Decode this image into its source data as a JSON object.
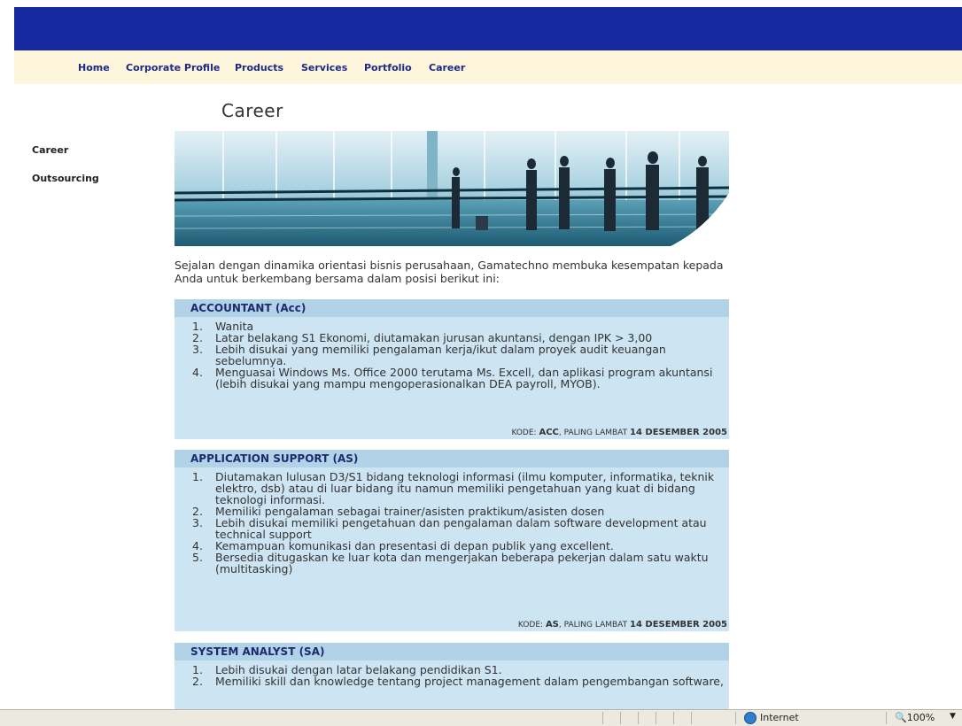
{
  "nav": {
    "items": [
      {
        "label": "Home"
      },
      {
        "label": "Corporate Profile"
      },
      {
        "label": "Products"
      },
      {
        "label": "Services"
      },
      {
        "label": "Portfolio"
      },
      {
        "label": "Career"
      }
    ]
  },
  "sidebar": {
    "items": [
      {
        "label": "Career"
      },
      {
        "label": "Outsourcing"
      }
    ]
  },
  "page": {
    "title": "Career",
    "intro": "Sejalan dengan dinamika orientasi bisnis perusahaan, Gamatechno membuka kesempatan kepada Anda untuk berkembang bersama dalam posisi berikut ini:"
  },
  "jobs": [
    {
      "title": "ACCOUNTANT (Acc)",
      "items": [
        "Wanita",
        "Latar belakang S1 Ekonomi, diutamakan jurusan akuntansi, dengan IPK > 3,00",
        "Lebih disukai yang memiliki pengalaman kerja/ikut dalam proyek audit keuangan sebelumnya.",
        "Menguasai Windows Ms. Office 2000 terutama Ms. Excell, dan aplikasi program akuntansi (lebih disukai yang mampu mengoperasionalkan DEA payroll, MYOB)."
      ],
      "code_label": "KODE:",
      "code": "ACC",
      "deadline_label": ", PALING LAMBAT",
      "deadline": "14 DESEMBER 2005"
    },
    {
      "title": "APPLICATION SUPPORT (AS)",
      "items": [
        "Diutamakan lulusan D3/S1 bidang teknologi informasi (ilmu komputer, informatika, teknik elektro, dsb) atau di luar bidang itu namun memiliki pengetahuan yang kuat di bidang teknologi informasi.",
        "Memiliki pengalaman sebagai trainer/asisten praktikum/asisten dosen",
        "Lebih disukai memiliki pengetahuan dan pengalaman dalam software development atau technical support",
        "Kemampuan komunikasi dan presentasi di depan publik yang excellent.",
        "Bersedia ditugaskan ke luar kota dan mengerjakan beberapa pekerjan dalam satu waktu (multitasking)"
      ],
      "code_label": "KODE:",
      "code": "AS",
      "deadline_label": ", PALING LAMBAT",
      "deadline": "14 DESEMBER 2005"
    },
    {
      "title": "SYSTEM ANALYST (SA)",
      "items": [
        "Lebih disukai dengan latar belakang pendidikan S1.",
        "Memiliki skill dan knowledge tentang project management dalam pengembangan software,"
      ]
    }
  ],
  "statusbar": {
    "zone": "Internet",
    "zoom": "100%"
  }
}
